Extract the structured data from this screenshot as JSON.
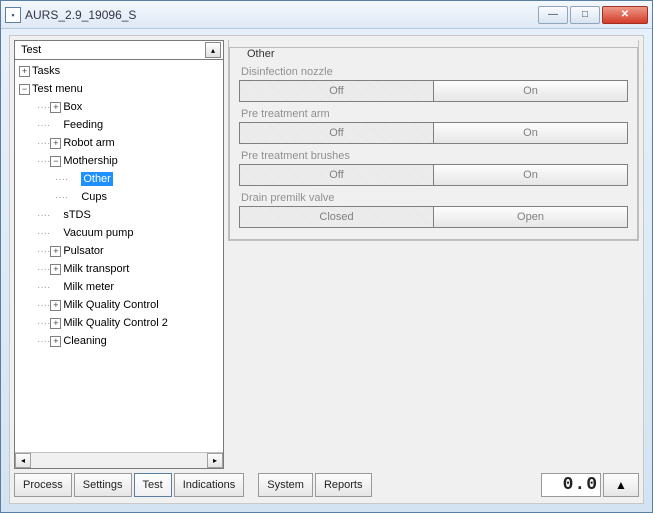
{
  "window": {
    "title": "AURS_2.9_19096_S"
  },
  "dropdown": {
    "label": "Test"
  },
  "tree": {
    "items": [
      {
        "label": "Tasks",
        "depth": 0,
        "exp": "+"
      },
      {
        "label": "Test menu",
        "depth": 0,
        "exp": "-"
      },
      {
        "label": "Box",
        "depth": 1,
        "exp": "+"
      },
      {
        "label": "Feeding",
        "depth": 1,
        "exp": ""
      },
      {
        "label": "Robot arm",
        "depth": 1,
        "exp": "+"
      },
      {
        "label": "Mothership",
        "depth": 1,
        "exp": "-"
      },
      {
        "label": "Other",
        "depth": 2,
        "exp": "",
        "selected": true
      },
      {
        "label": "Cups",
        "depth": 2,
        "exp": ""
      },
      {
        "label": "sTDS",
        "depth": 1,
        "exp": ""
      },
      {
        "label": "Vacuum pump",
        "depth": 1,
        "exp": ""
      },
      {
        "label": "Pulsator",
        "depth": 1,
        "exp": "+"
      },
      {
        "label": "Milk transport",
        "depth": 1,
        "exp": "+"
      },
      {
        "label": "Milk meter",
        "depth": 1,
        "exp": ""
      },
      {
        "label": "Milk Quality Control",
        "depth": 1,
        "exp": "+"
      },
      {
        "label": "Milk Quality Control 2",
        "depth": 1,
        "exp": "+"
      },
      {
        "label": "Cleaning",
        "depth": 1,
        "exp": "+"
      }
    ]
  },
  "panel": {
    "group_title": "Other",
    "fields": [
      {
        "label": "Disinfection nozzle",
        "left": "Off",
        "right": "On"
      },
      {
        "label": "Pre treatment arm",
        "left": "Off",
        "right": "On"
      },
      {
        "label": "Pre treatment brushes",
        "left": "Off",
        "right": "On"
      },
      {
        "label": "Drain premilk valve",
        "left": "Closed",
        "right": "Open"
      }
    ]
  },
  "tabs": {
    "items": [
      "Process",
      "Settings",
      "Test",
      "Indications",
      "System",
      "Reports"
    ],
    "active": 2
  },
  "status": {
    "digital": "0.0",
    "triangle": "▲"
  }
}
